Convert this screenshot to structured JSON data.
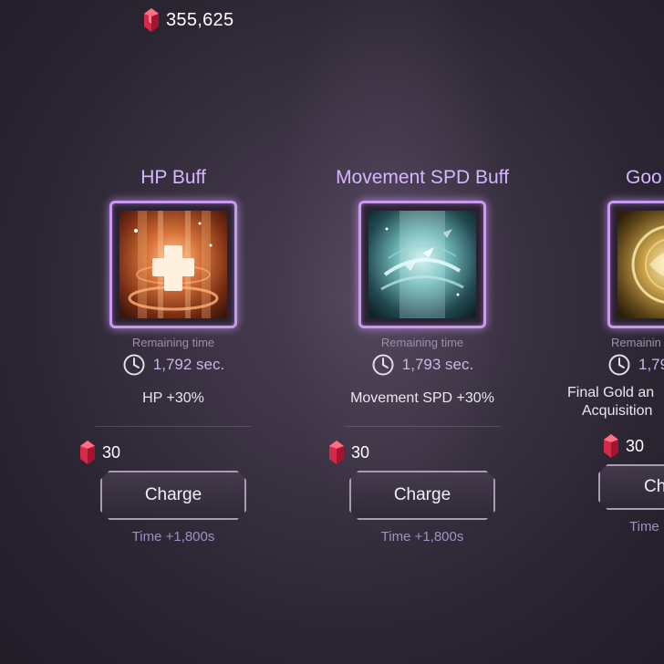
{
  "currency": {
    "amount": "355,625",
    "icon": "ruby-gem-icon"
  },
  "buffs": [
    {
      "title": "HP Buff",
      "icon": "hp-buff-icon",
      "remaining_label": "Remaining time",
      "remaining_time": "1,792 sec.",
      "effect_line1": "HP +30%",
      "effect_line2": "",
      "cost": "30",
      "charge_label": "Charge",
      "time_add": "Time +1,800s"
    },
    {
      "title": "Movement SPD Buff",
      "icon": "movement-speed-buff-icon",
      "remaining_label": "Remaining time",
      "remaining_time": "1,793 sec.",
      "effect_line1": "Movement SPD +30%",
      "effect_line2": "",
      "cost": "30",
      "charge_label": "Charge",
      "time_add": "Time +1,800s"
    },
    {
      "title": "Goo",
      "icon": "gold-buff-icon",
      "remaining_label": "Remainin",
      "remaining_time": "1,79",
      "effect_line1": "Final Gold an",
      "effect_line2": "Acquisition",
      "cost": "30",
      "charge_label": "Ch",
      "time_add": "Time"
    }
  ],
  "colors": {
    "accent": "#c89af0",
    "title": "#d6b6ff",
    "gem": "#e0344f"
  }
}
